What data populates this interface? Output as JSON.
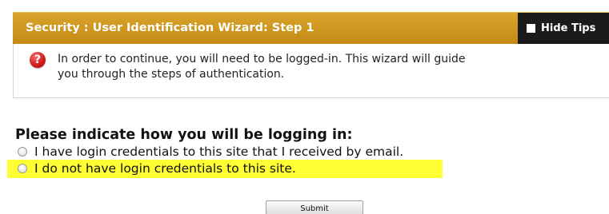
{
  "panel": {
    "title": "Security : User Identification Wizard: Step 1",
    "hide_tips_label": "Hide Tips",
    "tip_icon": "question-mark-icon",
    "tip_text": "In order to continue, you will need to be logged-in. This wizard will guide\nyou through the steps of authentication."
  },
  "form": {
    "question": "Please indicate how you will be logging in:",
    "options": [
      {
        "label": "I have login credentials to this site that I received by email.",
        "selected": false,
        "highlighted": false
      },
      {
        "label": "I do not have login credentials to this site.",
        "selected": false,
        "highlighted": true
      }
    ],
    "submit_label": "Submit"
  },
  "colors": {
    "header_gold": "#c8901a",
    "hide_tips_bg": "#1b1b1b",
    "highlight": "#ffff33",
    "help_icon_red": "#d01919"
  }
}
